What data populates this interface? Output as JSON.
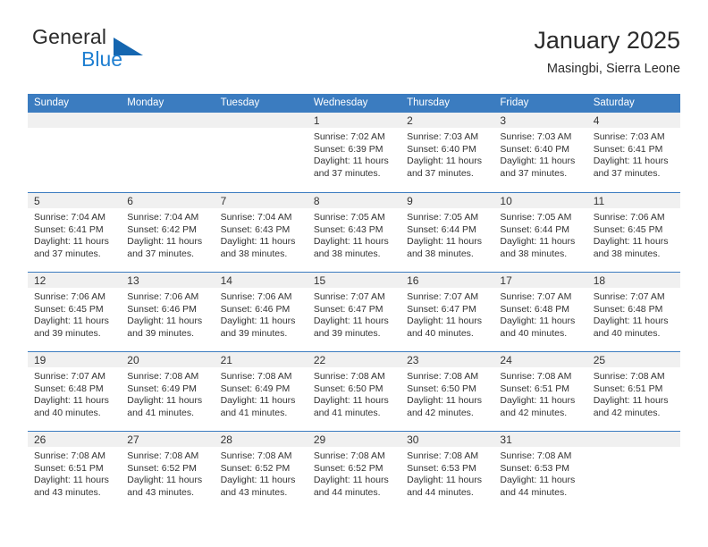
{
  "brand": {
    "word_one": "General",
    "word_two": "Blue",
    "triangle_icon": "blue-triangle-icon",
    "colors": {
      "general": "#2b2b2b",
      "blue": "#1f7fd1",
      "triangle": "#1566b0"
    }
  },
  "header": {
    "title": "January 2025",
    "location": "Masingbi, Sierra Leone"
  },
  "theme": {
    "header_bg": "#3b7cc0",
    "header_text": "#ffffff",
    "daynum_band_bg": "#f0f0f0",
    "row_separator": "#3b7cc0",
    "body_text": "#333333"
  },
  "calendar": {
    "weekday_headers": [
      "Sunday",
      "Monday",
      "Tuesday",
      "Wednesday",
      "Thursday",
      "Friday",
      "Saturday"
    ],
    "weeks": [
      [
        {
          "day": "",
          "lines": []
        },
        {
          "day": "",
          "lines": []
        },
        {
          "day": "",
          "lines": []
        },
        {
          "day": "1",
          "lines": [
            "Sunrise: 7:02 AM",
            "Sunset: 6:39 PM",
            "Daylight: 11 hours",
            "and 37 minutes."
          ]
        },
        {
          "day": "2",
          "lines": [
            "Sunrise: 7:03 AM",
            "Sunset: 6:40 PM",
            "Daylight: 11 hours",
            "and 37 minutes."
          ]
        },
        {
          "day": "3",
          "lines": [
            "Sunrise: 7:03 AM",
            "Sunset: 6:40 PM",
            "Daylight: 11 hours",
            "and 37 minutes."
          ]
        },
        {
          "day": "4",
          "lines": [
            "Sunrise: 7:03 AM",
            "Sunset: 6:41 PM",
            "Daylight: 11 hours",
            "and 37 minutes."
          ]
        }
      ],
      [
        {
          "day": "5",
          "lines": [
            "Sunrise: 7:04 AM",
            "Sunset: 6:41 PM",
            "Daylight: 11 hours",
            "and 37 minutes."
          ]
        },
        {
          "day": "6",
          "lines": [
            "Sunrise: 7:04 AM",
            "Sunset: 6:42 PM",
            "Daylight: 11 hours",
            "and 37 minutes."
          ]
        },
        {
          "day": "7",
          "lines": [
            "Sunrise: 7:04 AM",
            "Sunset: 6:43 PM",
            "Daylight: 11 hours",
            "and 38 minutes."
          ]
        },
        {
          "day": "8",
          "lines": [
            "Sunrise: 7:05 AM",
            "Sunset: 6:43 PM",
            "Daylight: 11 hours",
            "and 38 minutes."
          ]
        },
        {
          "day": "9",
          "lines": [
            "Sunrise: 7:05 AM",
            "Sunset: 6:44 PM",
            "Daylight: 11 hours",
            "and 38 minutes."
          ]
        },
        {
          "day": "10",
          "lines": [
            "Sunrise: 7:05 AM",
            "Sunset: 6:44 PM",
            "Daylight: 11 hours",
            "and 38 minutes."
          ]
        },
        {
          "day": "11",
          "lines": [
            "Sunrise: 7:06 AM",
            "Sunset: 6:45 PM",
            "Daylight: 11 hours",
            "and 38 minutes."
          ]
        }
      ],
      [
        {
          "day": "12",
          "lines": [
            "Sunrise: 7:06 AM",
            "Sunset: 6:45 PM",
            "Daylight: 11 hours",
            "and 39 minutes."
          ]
        },
        {
          "day": "13",
          "lines": [
            "Sunrise: 7:06 AM",
            "Sunset: 6:46 PM",
            "Daylight: 11 hours",
            "and 39 minutes."
          ]
        },
        {
          "day": "14",
          "lines": [
            "Sunrise: 7:06 AM",
            "Sunset: 6:46 PM",
            "Daylight: 11 hours",
            "and 39 minutes."
          ]
        },
        {
          "day": "15",
          "lines": [
            "Sunrise: 7:07 AM",
            "Sunset: 6:47 PM",
            "Daylight: 11 hours",
            "and 39 minutes."
          ]
        },
        {
          "day": "16",
          "lines": [
            "Sunrise: 7:07 AM",
            "Sunset: 6:47 PM",
            "Daylight: 11 hours",
            "and 40 minutes."
          ]
        },
        {
          "day": "17",
          "lines": [
            "Sunrise: 7:07 AM",
            "Sunset: 6:48 PM",
            "Daylight: 11 hours",
            "and 40 minutes."
          ]
        },
        {
          "day": "18",
          "lines": [
            "Sunrise: 7:07 AM",
            "Sunset: 6:48 PM",
            "Daylight: 11 hours",
            "and 40 minutes."
          ]
        }
      ],
      [
        {
          "day": "19",
          "lines": [
            "Sunrise: 7:07 AM",
            "Sunset: 6:48 PM",
            "Daylight: 11 hours",
            "and 40 minutes."
          ]
        },
        {
          "day": "20",
          "lines": [
            "Sunrise: 7:08 AM",
            "Sunset: 6:49 PM",
            "Daylight: 11 hours",
            "and 41 minutes."
          ]
        },
        {
          "day": "21",
          "lines": [
            "Sunrise: 7:08 AM",
            "Sunset: 6:49 PM",
            "Daylight: 11 hours",
            "and 41 minutes."
          ]
        },
        {
          "day": "22",
          "lines": [
            "Sunrise: 7:08 AM",
            "Sunset: 6:50 PM",
            "Daylight: 11 hours",
            "and 41 minutes."
          ]
        },
        {
          "day": "23",
          "lines": [
            "Sunrise: 7:08 AM",
            "Sunset: 6:50 PM",
            "Daylight: 11 hours",
            "and 42 minutes."
          ]
        },
        {
          "day": "24",
          "lines": [
            "Sunrise: 7:08 AM",
            "Sunset: 6:51 PM",
            "Daylight: 11 hours",
            "and 42 minutes."
          ]
        },
        {
          "day": "25",
          "lines": [
            "Sunrise: 7:08 AM",
            "Sunset: 6:51 PM",
            "Daylight: 11 hours",
            "and 42 minutes."
          ]
        }
      ],
      [
        {
          "day": "26",
          "lines": [
            "Sunrise: 7:08 AM",
            "Sunset: 6:51 PM",
            "Daylight: 11 hours",
            "and 43 minutes."
          ]
        },
        {
          "day": "27",
          "lines": [
            "Sunrise: 7:08 AM",
            "Sunset: 6:52 PM",
            "Daylight: 11 hours",
            "and 43 minutes."
          ]
        },
        {
          "day": "28",
          "lines": [
            "Sunrise: 7:08 AM",
            "Sunset: 6:52 PM",
            "Daylight: 11 hours",
            "and 43 minutes."
          ]
        },
        {
          "day": "29",
          "lines": [
            "Sunrise: 7:08 AM",
            "Sunset: 6:52 PM",
            "Daylight: 11 hours",
            "and 44 minutes."
          ]
        },
        {
          "day": "30",
          "lines": [
            "Sunrise: 7:08 AM",
            "Sunset: 6:53 PM",
            "Daylight: 11 hours",
            "and 44 minutes."
          ]
        },
        {
          "day": "31",
          "lines": [
            "Sunrise: 7:08 AM",
            "Sunset: 6:53 PM",
            "Daylight: 11 hours",
            "and 44 minutes."
          ]
        },
        {
          "day": "",
          "lines": []
        }
      ]
    ]
  }
}
